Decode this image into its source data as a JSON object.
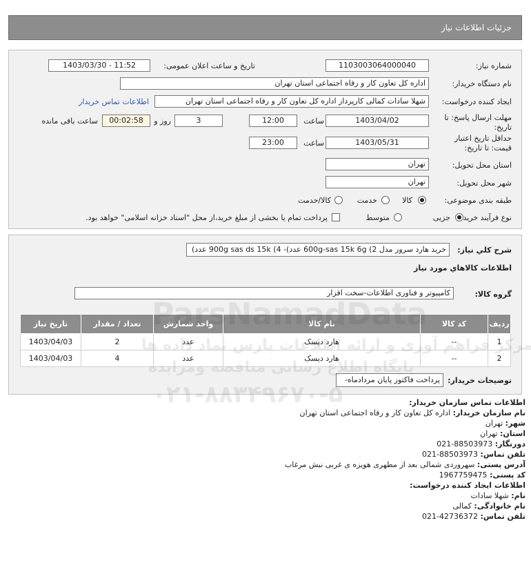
{
  "header": {
    "title": "جزئیات اطلاعات نیاز"
  },
  "form": {
    "need_number_label": "شماره نیاز:",
    "need_number": "1103003064000040",
    "announce_label": "تاریخ و ساعت اعلان عمومی:",
    "announce_value": "1403/03/30 - 11:52",
    "buyer_org_label": "نام دستگاه خریدار:",
    "buyer_org": "اداره کل تعاون  کار و رفاه اجتماعی استان تهران",
    "creator_label": "ایجاد کننده درخواست:",
    "creator": "شهلا سادات کمالی کارپرداز اداره کل تعاون  کار و رفاه اجتماعی استان تهران",
    "contact_link": "اطلاعات تماس خریدار",
    "deadline_label": "مهلت ارسال پاسخ: تا تاریخ:",
    "deadline_date": "1403/04/02",
    "time_label": "ساعت",
    "deadline_time": "12:00",
    "days_value": "3",
    "days_label": "روز و",
    "remaining_time": "00:02:58",
    "remaining_label": "ساعت باقی مانده",
    "validity_label": "حداقل تاریخ اعتبار قیمت: تا تاریخ:",
    "validity_date": "1403/05/31",
    "validity_time": "23:00",
    "province_label": "استان محل تحویل:",
    "province": "تهران",
    "city_label": "شهر محل تحویل:",
    "city": "تهران",
    "category_label": "طبقه بندی موضوعی:",
    "category_options": [
      "کالا",
      "خدمت",
      "کالا/خدمت"
    ],
    "process_label": "نوع فرآیند خرید :",
    "process_options": [
      "جزیی",
      "متوسط"
    ],
    "payment_note": "پرداخت تمام یا بخشی از مبلغ خرید،از محل \"اسناد خزانه اسلامی\" خواهد بود."
  },
  "summary": {
    "label": "شرح کلي نياز:",
    "value": "خرید هارد سرور مدل 2) 600g-sas 15k 6g عدد)- 4) 900g sas ds 15k عدد)"
  },
  "goods": {
    "section_title": "اطلاعات کالاهاي مورد نياز",
    "group_label": "گروه کالا:",
    "group_value": "کامپیوتر و فناوری اطلاعات-سخت افزار",
    "headers": [
      "رديف",
      "کد کالا",
      "نام کالا",
      "واحد شمارش",
      "تعداد / مقدار",
      "تاريخ نياز"
    ],
    "rows": [
      [
        "1",
        "--",
        "هارد دیسک",
        "عدد",
        "2",
        "1403/04/03"
      ],
      [
        "2",
        "--",
        "هارد دیسک",
        "عدد",
        "4",
        "1403/04/03"
      ]
    ],
    "buyer_notes_label": "توضیحات خریدار:",
    "buyer_notes": "پرداخت فاکتور پایان مردادماه-"
  },
  "contact": {
    "title": "اطلاعات تماس سازمان خریدار:",
    "name_label": "نام سازمان خریدار:",
    "name_value": "اداره کل تعاون کار و رفاه اجتماعی استان تهران",
    "city_label": "شهر:",
    "city_value": "تهران",
    "province_label": "استان:",
    "province_value": "تهران",
    "fax_label": "دورنگار:",
    "fax_value": "88503973-021",
    "phone_label": "تلفن تماس:",
    "phone_value": "88503973-021",
    "address_label": "آدرس پستی:",
    "address_value": "سهروردی شمالی بعد از مطهری هویزه ی غربی نبش مرغاب",
    "postal_label": "کد پستی:",
    "postal_value": "1967759475",
    "creator_title": "اطلاعات ایجاد کننده درخواست:",
    "first_label": "نام:",
    "first_value": "شهلا سادات",
    "last_label": "نام خانوادگی:",
    "last_value": "کمالی",
    "creator_phone_label": "تلفن تماس:",
    "creator_phone_value": "42736372-021"
  },
  "watermark": {
    "brand": "ParsNamadData",
    "line1": "مرکز فراهم آوری و ارائه اطلاعات پارس نماد داده ها",
    "line2": "پایگاه اطلاع رسانی مناقصه ومزایده",
    "phone": "۰۲۱-۸۸۳۴۹۶۷۰-۵"
  }
}
